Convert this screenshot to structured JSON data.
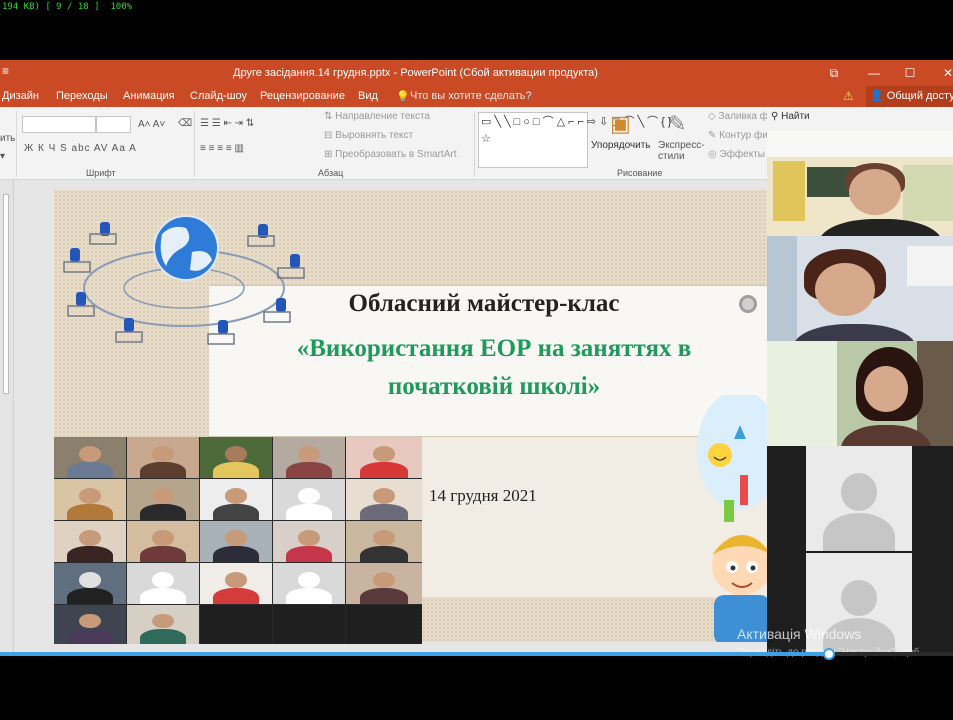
{
  "player": {
    "status_text": "194 KB) [ 9 / 18 ]  100%",
    "progress": 0.87
  },
  "window": {
    "title": "Друге засідання.14 грудня.pptx - PowerPoint (Сбой активации продукта)",
    "menu_glyph": "≡",
    "restore_glyph": "⧉",
    "minimize_glyph": "—",
    "maximize_glyph": "☐",
    "close_glyph": "✕"
  },
  "ribbon_tabs": {
    "items": [
      "Дизайн",
      "Переходы",
      "Анимация",
      "Слайд-шоу",
      "Рецензирование",
      "Вид"
    ],
    "tell_me": "Что вы хотите сделать?",
    "warning_glyph": "⚠",
    "share": "Общий доступ"
  },
  "ribbon": {
    "paste_fragment": "ить",
    "font_group": "Шрифт",
    "font_formats": "Ж  К  Ч  S  abc  AV  Aa  A",
    "font_grow": "A˄  A˅",
    "paragraph_group": "Абзац",
    "text_direction": "Направление текста",
    "align_text": "Выровнять текст",
    "smartart": "Преобразовать в SmartArt",
    "list_glyphs": "☰ ☰  ⇤ ⇥  ⇅",
    "align_glyphs": "≡ ≡ ≡ ≡  ▥",
    "shapes_glyphs": "▭╲╲□○□⌒△⌐⌐⇨⇩◻⌒╲⌒{}☆",
    "arrange": "Упорядочить",
    "quick_styles": "Экспресс-стили",
    "drawing_group": "Рисование",
    "shape_fill": "Заливка фигуры",
    "shape_outline": "Контур фи",
    "shape_effects": "Эффекты",
    "find": "Найти"
  },
  "slide": {
    "title": "Обласний майстер-клас",
    "subtitle": "«Використання ЕОР на заняттях в початковій школі»",
    "date": "14 грудня 2021"
  },
  "watermark": {
    "title": "Активація Windows",
    "sub": "Перейдіть до розділу \"Настройки\", щоб"
  }
}
